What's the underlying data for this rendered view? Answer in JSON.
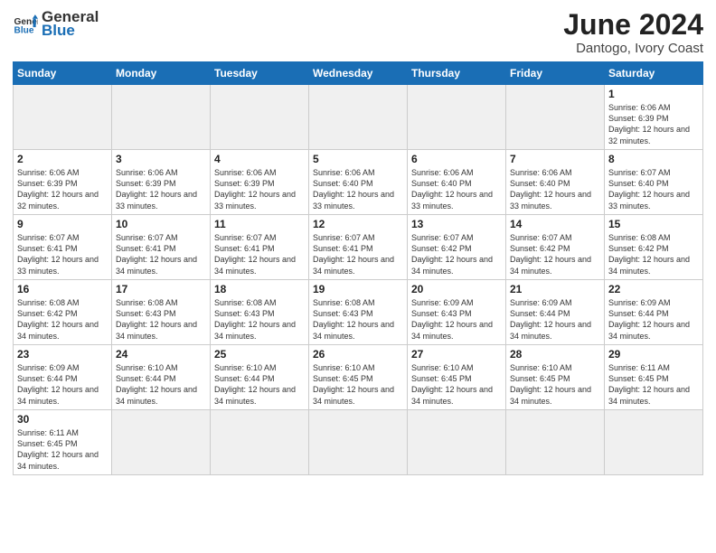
{
  "header": {
    "logo_general": "General",
    "logo_blue": "Blue",
    "title": "June 2024",
    "location": "Dantogo, Ivory Coast"
  },
  "days_of_week": [
    "Sunday",
    "Monday",
    "Tuesday",
    "Wednesday",
    "Thursday",
    "Friday",
    "Saturday"
  ],
  "weeks": [
    [
      {
        "day": "",
        "empty": true
      },
      {
        "day": "",
        "empty": true
      },
      {
        "day": "",
        "empty": true
      },
      {
        "day": "",
        "empty": true
      },
      {
        "day": "",
        "empty": true
      },
      {
        "day": "",
        "empty": true
      },
      {
        "day": "1",
        "sunrise": "6:06 AM",
        "sunset": "6:39 PM",
        "daylight": "12 hours and 32 minutes."
      }
    ],
    [
      {
        "day": "2",
        "sunrise": "6:06 AM",
        "sunset": "6:39 PM",
        "daylight": "12 hours and 32 minutes."
      },
      {
        "day": "3",
        "sunrise": "6:06 AM",
        "sunset": "6:39 PM",
        "daylight": "12 hours and 33 minutes."
      },
      {
        "day": "4",
        "sunrise": "6:06 AM",
        "sunset": "6:39 PM",
        "daylight": "12 hours and 33 minutes."
      },
      {
        "day": "5",
        "sunrise": "6:06 AM",
        "sunset": "6:40 PM",
        "daylight": "12 hours and 33 minutes."
      },
      {
        "day": "6",
        "sunrise": "6:06 AM",
        "sunset": "6:40 PM",
        "daylight": "12 hours and 33 minutes."
      },
      {
        "day": "7",
        "sunrise": "6:06 AM",
        "sunset": "6:40 PM",
        "daylight": "12 hours and 33 minutes."
      },
      {
        "day": "8",
        "sunrise": "6:07 AM",
        "sunset": "6:40 PM",
        "daylight": "12 hours and 33 minutes."
      }
    ],
    [
      {
        "day": "9",
        "sunrise": "6:07 AM",
        "sunset": "6:41 PM",
        "daylight": "12 hours and 33 minutes."
      },
      {
        "day": "10",
        "sunrise": "6:07 AM",
        "sunset": "6:41 PM",
        "daylight": "12 hours and 34 minutes."
      },
      {
        "day": "11",
        "sunrise": "6:07 AM",
        "sunset": "6:41 PM",
        "daylight": "12 hours and 34 minutes."
      },
      {
        "day": "12",
        "sunrise": "6:07 AM",
        "sunset": "6:41 PM",
        "daylight": "12 hours and 34 minutes."
      },
      {
        "day": "13",
        "sunrise": "6:07 AM",
        "sunset": "6:42 PM",
        "daylight": "12 hours and 34 minutes."
      },
      {
        "day": "14",
        "sunrise": "6:07 AM",
        "sunset": "6:42 PM",
        "daylight": "12 hours and 34 minutes."
      },
      {
        "day": "15",
        "sunrise": "6:08 AM",
        "sunset": "6:42 PM",
        "daylight": "12 hours and 34 minutes."
      }
    ],
    [
      {
        "day": "16",
        "sunrise": "6:08 AM",
        "sunset": "6:42 PM",
        "daylight": "12 hours and 34 minutes."
      },
      {
        "day": "17",
        "sunrise": "6:08 AM",
        "sunset": "6:43 PM",
        "daylight": "12 hours and 34 minutes."
      },
      {
        "day": "18",
        "sunrise": "6:08 AM",
        "sunset": "6:43 PM",
        "daylight": "12 hours and 34 minutes."
      },
      {
        "day": "19",
        "sunrise": "6:08 AM",
        "sunset": "6:43 PM",
        "daylight": "12 hours and 34 minutes."
      },
      {
        "day": "20",
        "sunrise": "6:09 AM",
        "sunset": "6:43 PM",
        "daylight": "12 hours and 34 minutes."
      },
      {
        "day": "21",
        "sunrise": "6:09 AM",
        "sunset": "6:44 PM",
        "daylight": "12 hours and 34 minutes."
      },
      {
        "day": "22",
        "sunrise": "6:09 AM",
        "sunset": "6:44 PM",
        "daylight": "12 hours and 34 minutes."
      }
    ],
    [
      {
        "day": "23",
        "sunrise": "6:09 AM",
        "sunset": "6:44 PM",
        "daylight": "12 hours and 34 minutes."
      },
      {
        "day": "24",
        "sunrise": "6:10 AM",
        "sunset": "6:44 PM",
        "daylight": "12 hours and 34 minutes."
      },
      {
        "day": "25",
        "sunrise": "6:10 AM",
        "sunset": "6:44 PM",
        "daylight": "12 hours and 34 minutes."
      },
      {
        "day": "26",
        "sunrise": "6:10 AM",
        "sunset": "6:45 PM",
        "daylight": "12 hours and 34 minutes."
      },
      {
        "day": "27",
        "sunrise": "6:10 AM",
        "sunset": "6:45 PM",
        "daylight": "12 hours and 34 minutes."
      },
      {
        "day": "28",
        "sunrise": "6:10 AM",
        "sunset": "6:45 PM",
        "daylight": "12 hours and 34 minutes."
      },
      {
        "day": "29",
        "sunrise": "6:11 AM",
        "sunset": "6:45 PM",
        "daylight": "12 hours and 34 minutes."
      }
    ],
    [
      {
        "day": "30",
        "sunrise": "6:11 AM",
        "sunset": "6:45 PM",
        "daylight": "12 hours and 34 minutes.",
        "last": true
      },
      {
        "day": "",
        "empty": true,
        "last": true
      },
      {
        "day": "",
        "empty": true,
        "last": true
      },
      {
        "day": "",
        "empty": true,
        "last": true
      },
      {
        "day": "",
        "empty": true,
        "last": true
      },
      {
        "day": "",
        "empty": true,
        "last": true
      },
      {
        "day": "",
        "empty": true,
        "last": true
      }
    ]
  ]
}
